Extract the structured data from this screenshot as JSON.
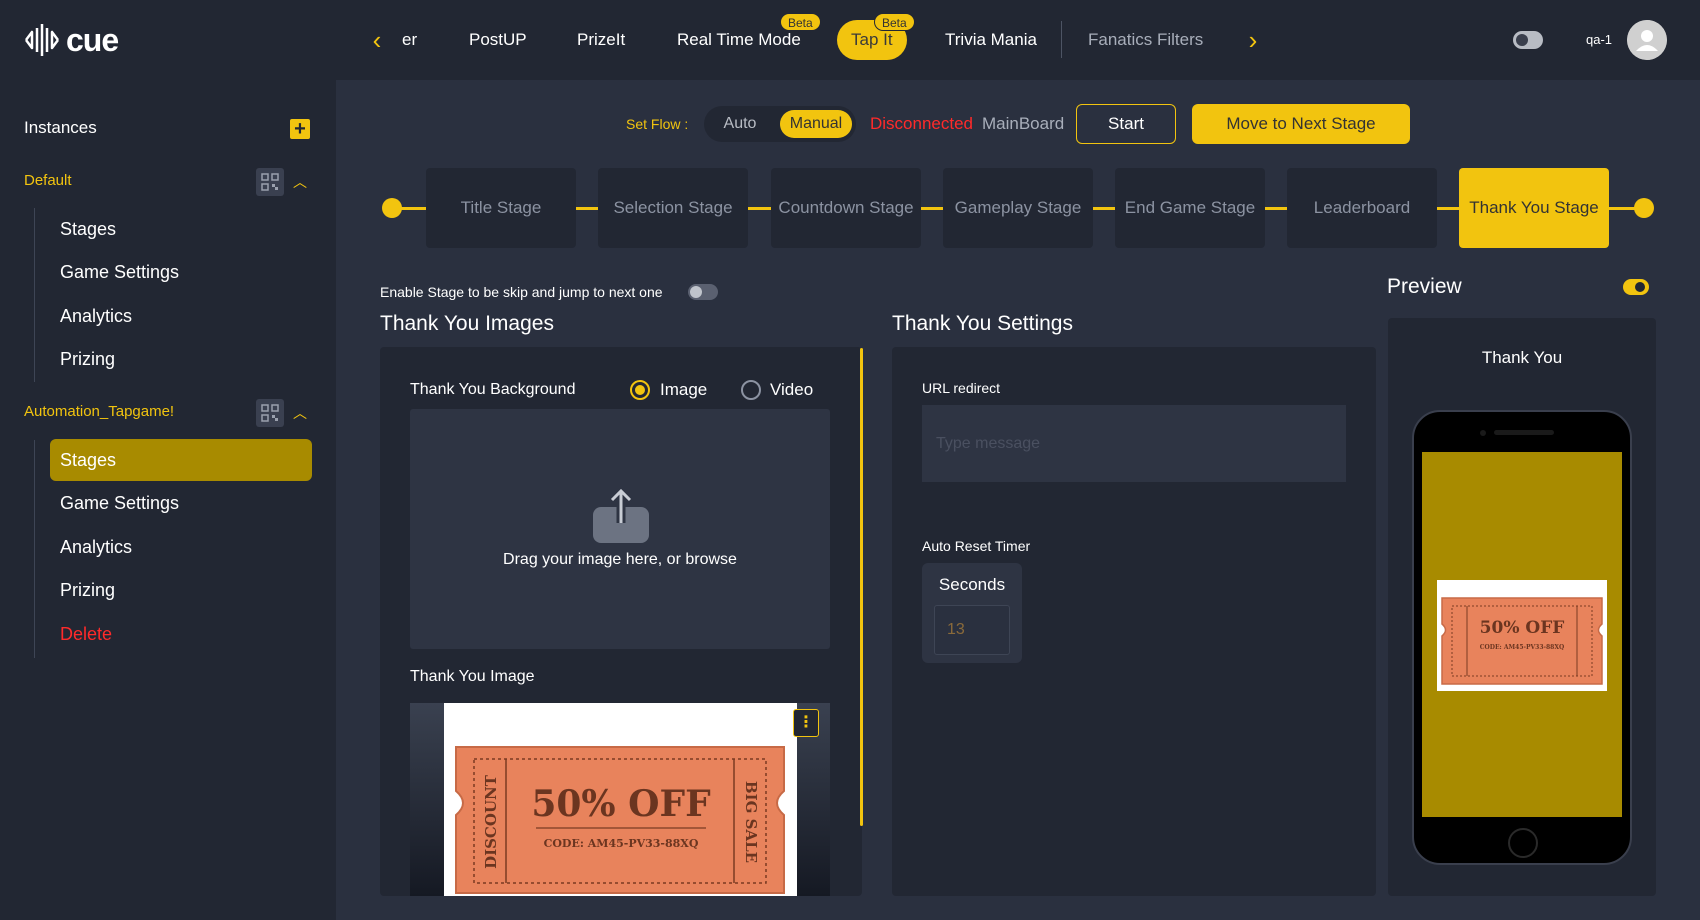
{
  "app": {
    "logo_text": "cue",
    "brand_color": "#f2c40f"
  },
  "topnav": {
    "tabs": [
      {
        "label": "er"
      },
      {
        "label": "PostUP"
      },
      {
        "label": "PrizeIt"
      },
      {
        "label": "Real Time Mode",
        "badge": "Beta"
      },
      {
        "label": "Tap It",
        "badge": "Beta",
        "active": true
      },
      {
        "label": "Trivia Mania"
      },
      {
        "label": "Fanatics Filters"
      }
    ],
    "user": "qa-1"
  },
  "sidebar": {
    "heading": "Instances",
    "groups": [
      {
        "name": "Default",
        "items": [
          "Stages",
          "Game Settings",
          "Analytics",
          "Prizing"
        ]
      },
      {
        "name": "Automation_Tapgame!",
        "items": [
          "Stages",
          "Game Settings",
          "Analytics",
          "Prizing",
          "Delete"
        ],
        "active_item": "Stages"
      }
    ]
  },
  "controls": {
    "set_flow_label": "Set Flow :",
    "flow_options": [
      "Auto",
      "Manual"
    ],
    "flow_selected": "Manual",
    "status": "Disconnected",
    "board": "MainBoard",
    "start_label": "Start",
    "next_label": "Move to Next Stage"
  },
  "stages": [
    "Title Stage",
    "Selection Stage",
    "Countdown Stage",
    "Gameplay Stage",
    "End Game Stage",
    "Leaderboard",
    "Thank You Stage"
  ],
  "active_stage": "Thank You Stage",
  "images": {
    "skip_label": "Enable Stage to be skip and jump to next one",
    "title": "Thank You Images",
    "background_label": "Thank You Background",
    "media_options": [
      "Image",
      "Video"
    ],
    "media_selected": "Image",
    "drop_text": "Drag your image here, or browse",
    "image_label": "Thank You Image"
  },
  "coupon": {
    "headline": "50% OFF",
    "code": "CODE: AM45-PV33-88XQ",
    "left_text": "DISCOUNT",
    "right_text": "BIG SALE",
    "color": "#e8835c"
  },
  "settings": {
    "title": "Thank You Settings",
    "url_label": "URL redirect",
    "url_placeholder": "Type message",
    "timer_label": "Auto Reset Timer",
    "timer_unit": "Seconds",
    "timer_value": "13"
  },
  "preview": {
    "title": "Preview",
    "caption": "Thank You"
  }
}
